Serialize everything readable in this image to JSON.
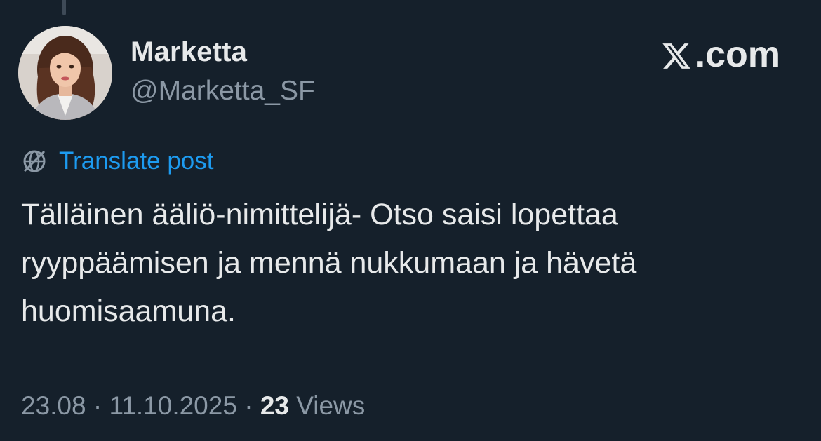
{
  "post": {
    "author_name": "Marketta",
    "author_handle": "@Marketta_SF",
    "brand": ".com",
    "translate_label": "Translate post",
    "text": "Tälläinen ääliö-nimittelijä- Otso saisi lopettaa ryyppäämisen ja mennä nukkumaan ja hävetä huomisaamuna.",
    "time": "23.08",
    "separator": " · ",
    "date": "11.10.2025",
    "views_count": "23",
    "views_label": "Views"
  },
  "icons": {
    "brand_logo": "x-logo-icon",
    "translate": "globe-slash-icon"
  },
  "colors": {
    "background": "#15202b",
    "text": "#e7e9ea",
    "secondary": "#8b98a5",
    "link": "#1d9bf0"
  }
}
